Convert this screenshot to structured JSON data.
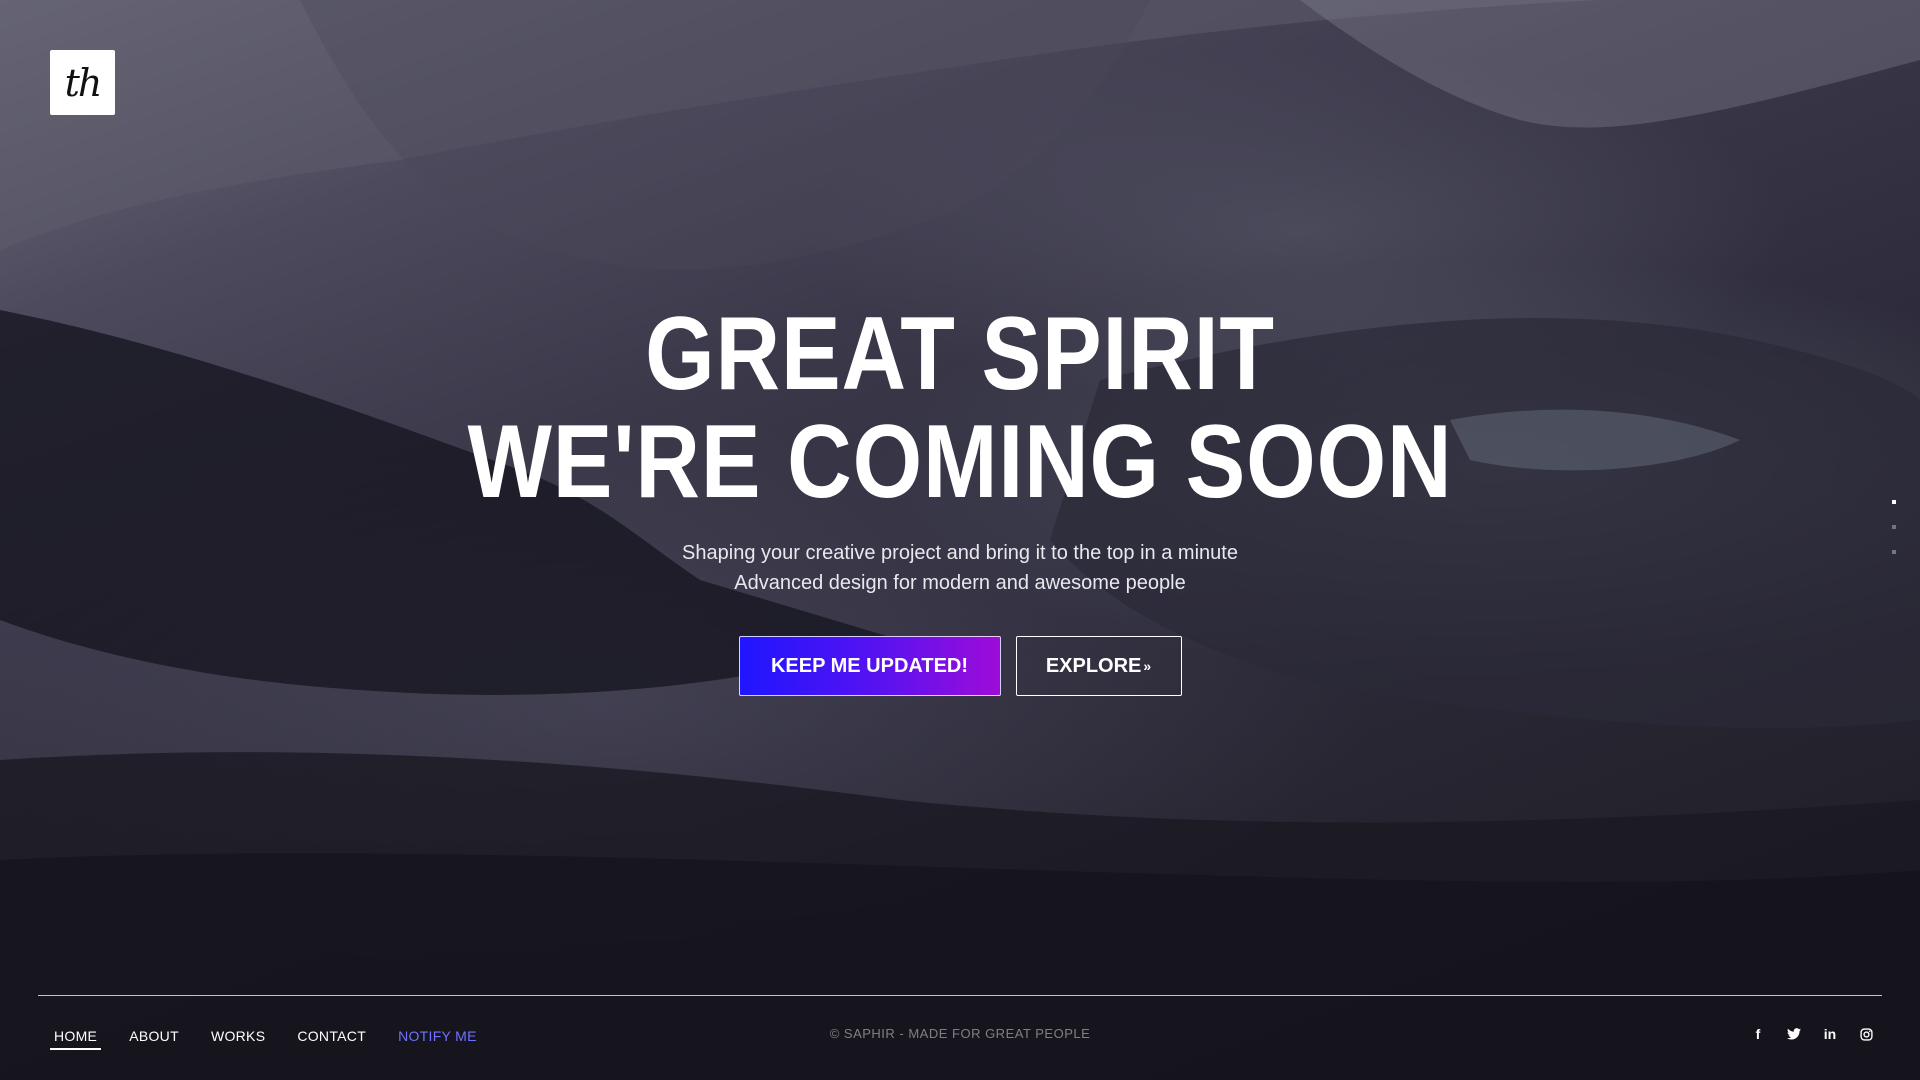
{
  "brand": {
    "logo_text": "th"
  },
  "hero": {
    "title_line1": "GREAT SPIRIT",
    "title_line2": "WE'RE COMING SOON",
    "subtitle_line1": "Shaping your creative project and bring it to the top in a minute",
    "subtitle_line2": "Advanced design for modern and awesome people"
  },
  "buttons": {
    "primary_label": "KEEP ME UPDATED!",
    "secondary_label": "EXPLORE",
    "secondary_icon": "chevron-double-down-icon"
  },
  "footer": {
    "nav": [
      {
        "label": "HOME",
        "state": "active"
      },
      {
        "label": "ABOUT",
        "state": ""
      },
      {
        "label": "WORKS",
        "state": ""
      },
      {
        "label": "CONTACT",
        "state": ""
      },
      {
        "label": "NOTIFY ME",
        "state": "accent"
      }
    ],
    "copyright": "© SAPHIR - MADE FOR GREAT PEOPLE",
    "social": [
      {
        "icon": "facebook-icon",
        "glyph": "f"
      },
      {
        "icon": "twitter-icon",
        "glyph": "🐦"
      },
      {
        "icon": "linkedin-icon",
        "glyph": "in"
      },
      {
        "icon": "instagram-icon",
        "glyph": "◎"
      }
    ]
  },
  "colors": {
    "primary_gradient_start": "#1f16ff",
    "primary_gradient_end": "#9e0cd8",
    "accent": "#6f73ff"
  }
}
